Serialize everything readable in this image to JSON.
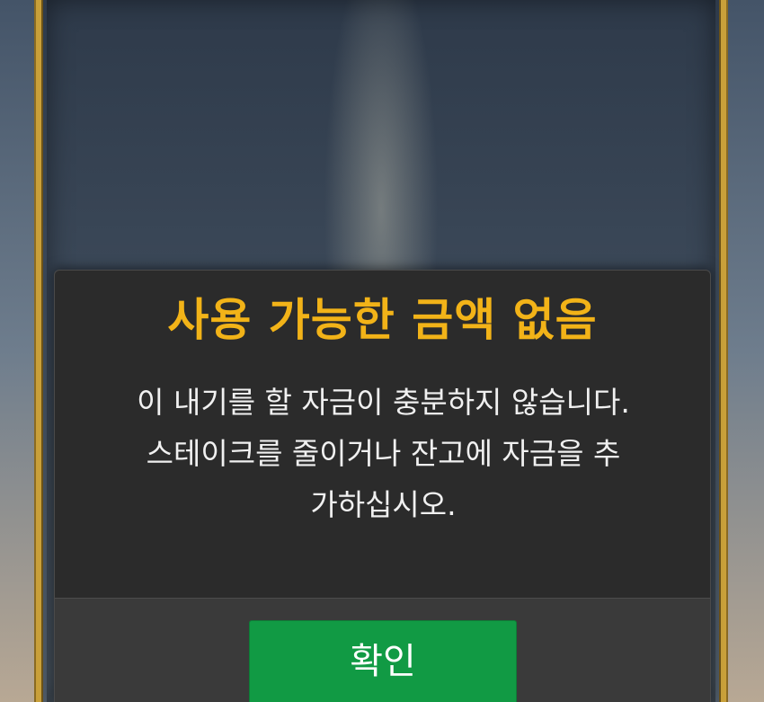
{
  "dialog": {
    "title": "사용 가능한 금액 없음",
    "message_lines": [
      "이 내기를 할 자금이 충분하지 않습니다.",
      "스테이크를 줄이거나 잔고에 자금을 추",
      "가하십시오."
    ],
    "confirm_label": "확인"
  },
  "colors": {
    "title": "#f2b318",
    "confirm_button": "#119a44",
    "frame_gold": "#c9a03a",
    "modal_background": "#2b2b2b"
  }
}
